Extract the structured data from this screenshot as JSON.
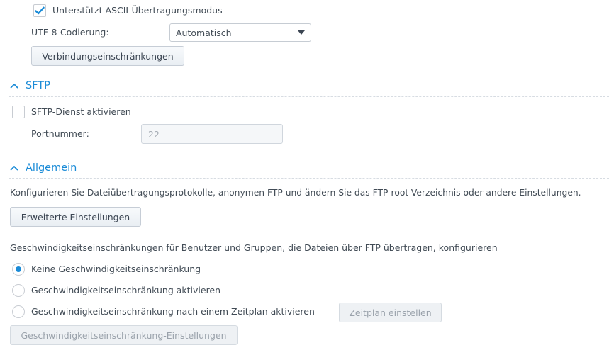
{
  "ftp": {
    "ascii_mode_label": "Unterstützt ASCII-Übertragungsmodus",
    "ascii_mode_checked": true,
    "utf8_label": "UTF-8-Codierung:",
    "utf8_value": "Automatisch",
    "connection_limits_button": "Verbindungseinschränkungen"
  },
  "sftp": {
    "title": "SFTP",
    "enable_label": "SFTP-Dienst aktivieren",
    "enable_checked": false,
    "port_label": "Portnummer:",
    "port_value": "22"
  },
  "general": {
    "title": "Allgemein",
    "description": "Konfigurieren Sie Dateiübertragungsprotokolle, anonymen FTP und ändern Sie das FTP-root-Verzeichnis oder andere Einstellungen.",
    "advanced_button": "Erweiterte Einstellungen",
    "speed_description": "Geschwindigkeitseinschränkungen für Benutzer und Gruppen, die Dateien über FTP übertragen, konfigurieren",
    "speed_options": [
      "Keine Geschwindigkeitseinschränkung",
      "Geschwindigkeitseinschränkung aktivieren",
      "Geschwindigkeitseinschränkung nach einem Zeitplan aktivieren"
    ],
    "speed_selected": "Keine Geschwindigkeitseinschränkung",
    "schedule_button": "Zeitplan einstellen",
    "speed_settings_button": "Geschwindigkeitseinschränkung-Einstellungen"
  },
  "colors": {
    "accent": "#1a8bd7",
    "text": "#414b55",
    "disabled_text": "#9aa2ab"
  }
}
